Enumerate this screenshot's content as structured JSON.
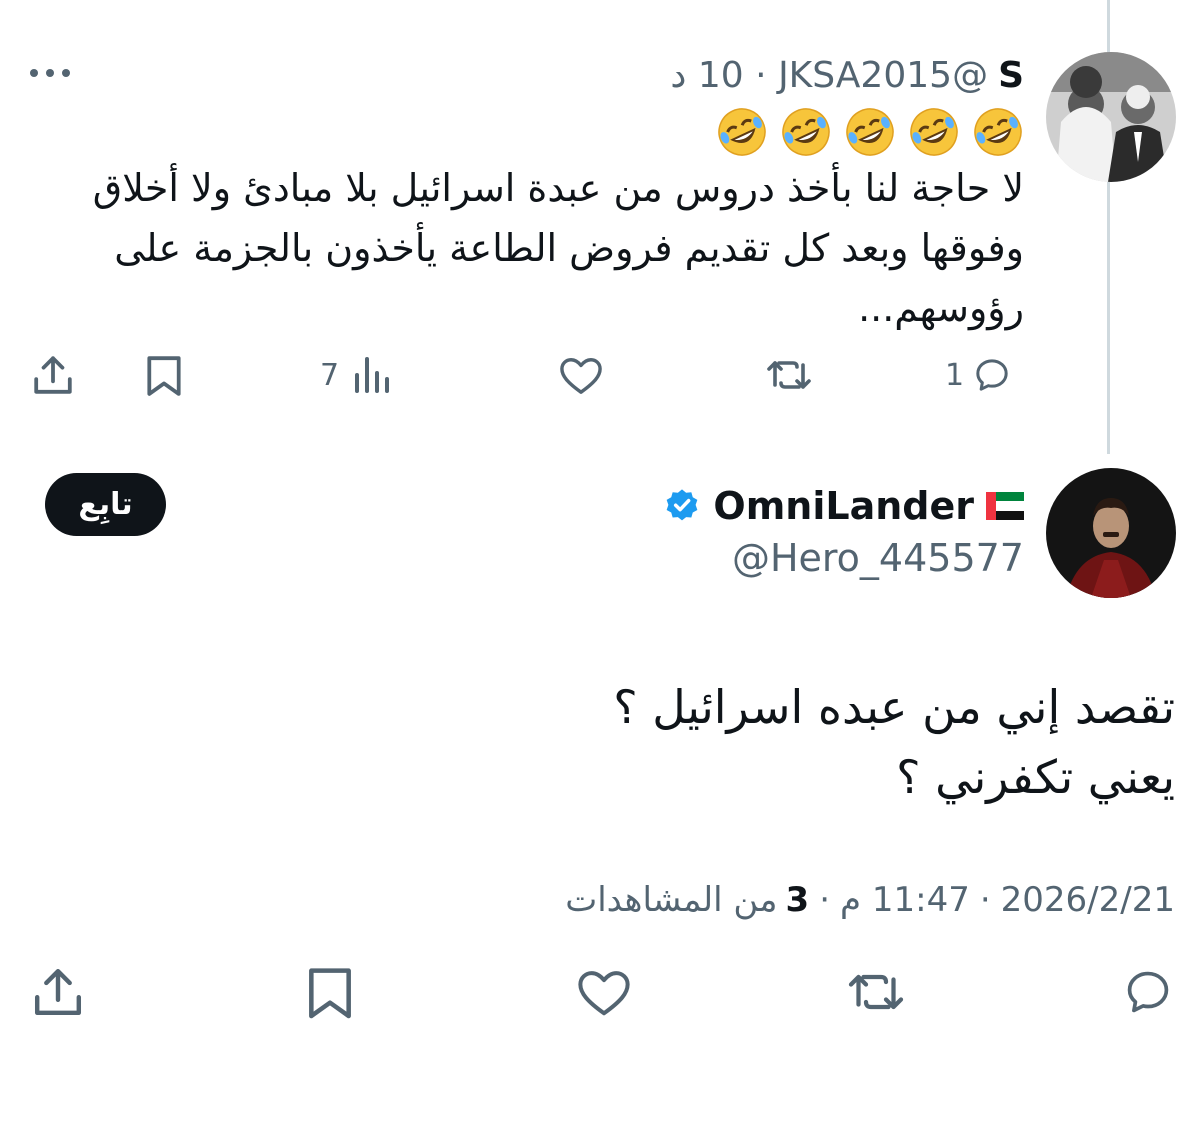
{
  "reply": {
    "display_name": "S",
    "handle": "@JKSA2015",
    "separator": "·",
    "time": "10 د",
    "emojis": [
      "rofl",
      "rofl",
      "rofl",
      "rofl",
      "rofl"
    ],
    "text": "لا حاجة لنا بأخذ دروس من عبدة اسرائيل بلا مبادئ ولا أخلاق وفوقها وبعد كل تقديم فروض الطاعة يأخذون بالجزمة على رؤوسهم...",
    "stats": {
      "replies": "1",
      "views": "7"
    },
    "icons": [
      "reply-icon",
      "retweet-icon",
      "like-icon",
      "views-icon",
      "bookmark-icon",
      "share-icon"
    ]
  },
  "main_tweet": {
    "display_name": "OmniLander",
    "flag": "uae-flag",
    "verified": "verified-badge",
    "handle": "@Hero_445577",
    "follow_label": "تابِع",
    "text_line1": "تقصد إني من عبده اسرائيل ؟",
    "text_line2": "يعني تكفرني ؟",
    "date": "2026/2/21",
    "time": "11:47 م",
    "views_count": "3",
    "views_label": "من المشاهدات",
    "separator": "·",
    "icons": [
      "reply-icon",
      "retweet-icon",
      "like-icon",
      "bookmark-icon",
      "share-icon"
    ]
  },
  "colors": {
    "text": "#0f1419",
    "muted": "#536471",
    "thread_line": "#cfd9de",
    "verified": "#1d9bf0",
    "button_bg": "#0f1419"
  }
}
